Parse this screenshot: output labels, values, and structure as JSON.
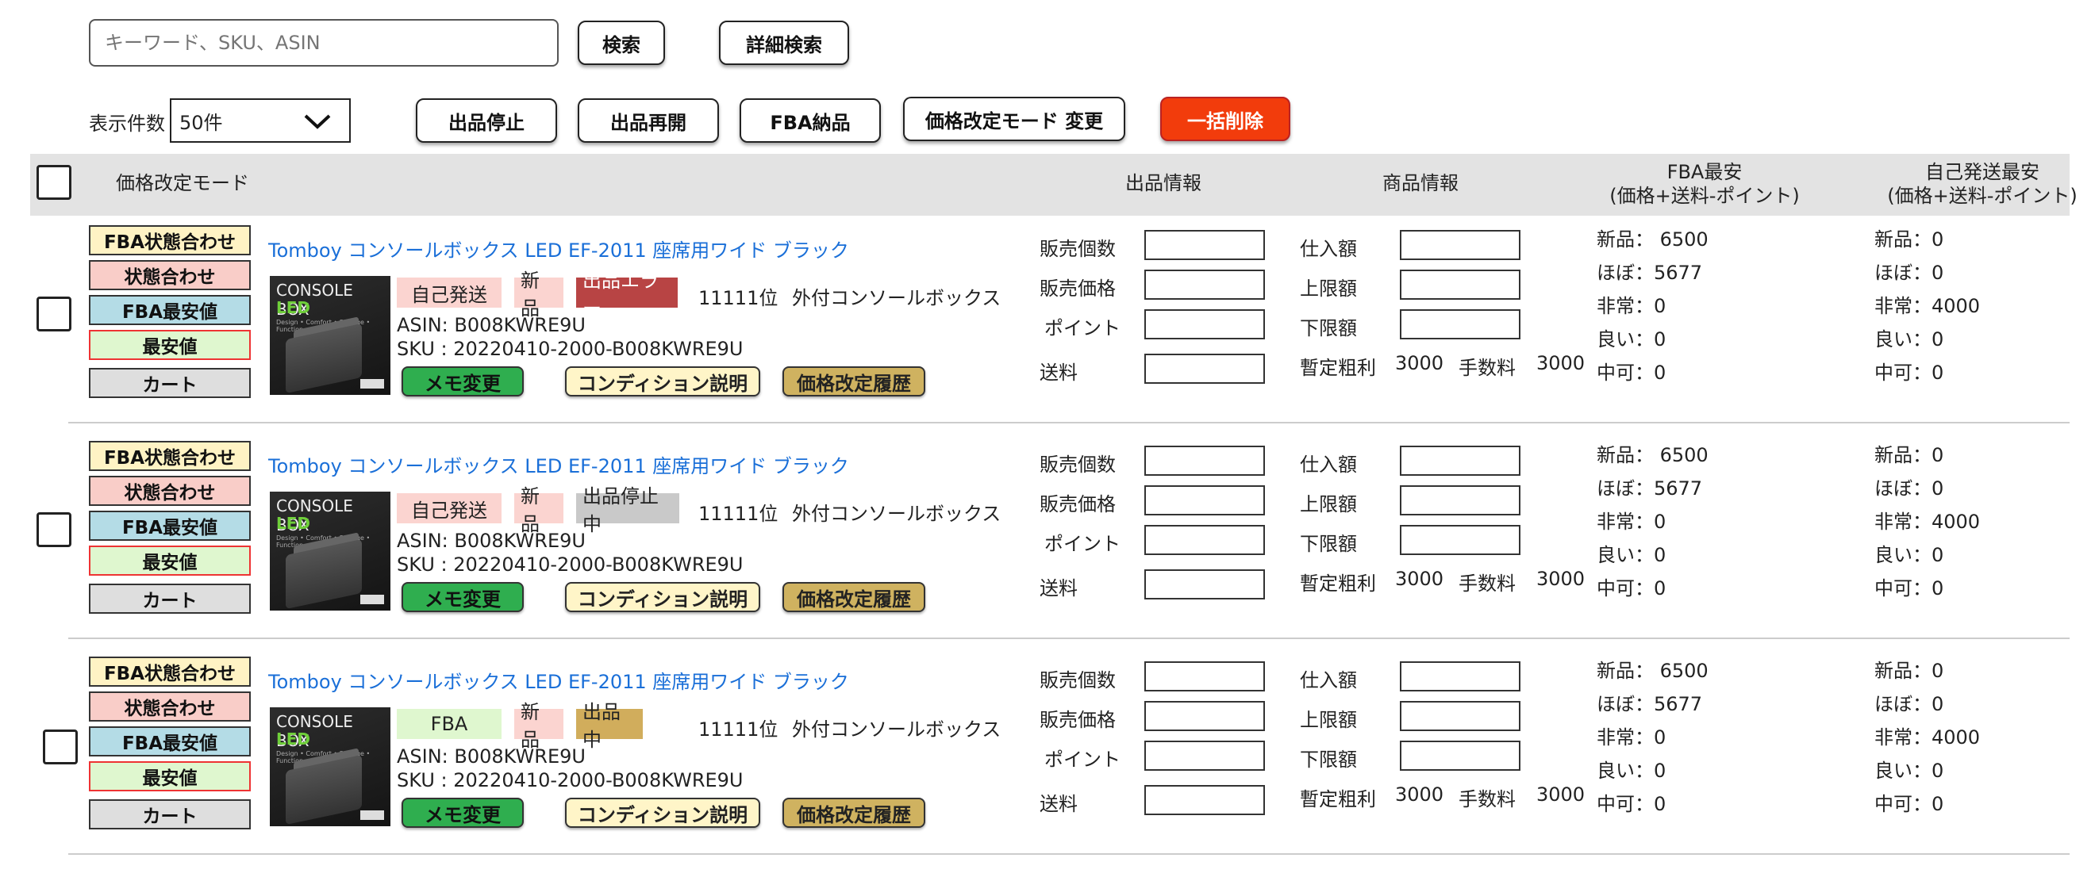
{
  "search": {
    "placeholder": "キーワード、SKU、ASIN",
    "search_label": "検索",
    "advanced_label": "詳細検索"
  },
  "toolbar": {
    "per_page_label": "表示件数",
    "per_page_value": "50件",
    "stop_label": "出品停止",
    "resume_label": "出品再開",
    "fba_label": "FBA納品",
    "mode_change_label": "価格改定モード 変更",
    "bulk_delete_label": "一括削除"
  },
  "header": {
    "mode": "価格改定モード",
    "listing_info": "出品情報",
    "product_info": "商品情報",
    "fba_lowest_1": "FBA最安",
    "fba_lowest_2": "(価格+送料-ポイント)",
    "self_lowest_1": "自己発送最安",
    "self_lowest_2": "(価格+送料-ポイント)"
  },
  "mode_buttons": [
    "FBA状態合わせ",
    "状態合わせ",
    "FBA最安値",
    "最安値",
    "カート"
  ],
  "field_labels": {
    "sales_count": "販売個数",
    "sales_price": "販売価格",
    "point": "ポイント",
    "shipping": "送料",
    "purchase": "仕入額",
    "upper": "上限額",
    "lower": "下限額",
    "profit": "暫定粗利",
    "fee": "手数料"
  },
  "thumb": {
    "line1": "CONSOLE BOX",
    "line2": "LED",
    "line3": "Design • Comfort • Storage • Function"
  },
  "actions": {
    "memo": "メモ変更",
    "condition": "コンディション説明",
    "history": "価格改定履歴"
  },
  "rows": [
    {
      "title": "Tomboy コンソールボックス LED EF-2011 座席用ワイド ブラック",
      "ship": "自己発送",
      "cond": "新品",
      "status": "出品エラー",
      "rank": "11111位",
      "category": "外付コンソールボックス",
      "asin": "ASIN: B008KWRE9U",
      "sku": "SKU : 20220410-2000-B008KWRE9U",
      "profit": "3000",
      "fee": "3000",
      "fba": [
        "新品： 6500",
        "ほぼ：5677",
        "非常：0",
        "良い：0",
        "中可：0"
      ],
      "self": [
        "新品：0",
        "ほぼ：0",
        "非常：4000",
        "良い：0",
        "中可：0"
      ]
    },
    {
      "title": "Tomboy コンソールボックス LED EF-2011 座席用ワイド ブラック",
      "ship": "自己発送",
      "cond": "新品",
      "status": "出品停止中",
      "rank": "11111位",
      "category": "外付コンソールボックス",
      "asin": "ASIN: B008KWRE9U",
      "sku": "SKU : 20220410-2000-B008KWRE9U",
      "profit": "3000",
      "fee": "3000",
      "fba": [
        "新品： 6500",
        "ほぼ：5677",
        "非常：0",
        "良い：0",
        "中可：0"
      ],
      "self": [
        "新品：0",
        "ほぼ：0",
        "非常：4000",
        "良い：0",
        "中可：0"
      ]
    },
    {
      "title": "Tomboy コンソールボックス LED EF-2011 座席用ワイド ブラック",
      "ship": "FBA",
      "cond": "新品",
      "status": "出品中",
      "rank": "11111位",
      "category": "外付コンソールボックス",
      "asin": "ASIN: B008KWRE9U",
      "sku": "SKU : 20220410-2000-B008KWRE9U",
      "profit": "3000",
      "fee": "3000",
      "fba": [
        "新品： 6500",
        "ほぼ：5677",
        "非常：0",
        "良い：0",
        "中可：0"
      ],
      "self": [
        "新品：0",
        "ほぼ：0",
        "非常：4000",
        "良い：0",
        "中可：0"
      ]
    }
  ]
}
